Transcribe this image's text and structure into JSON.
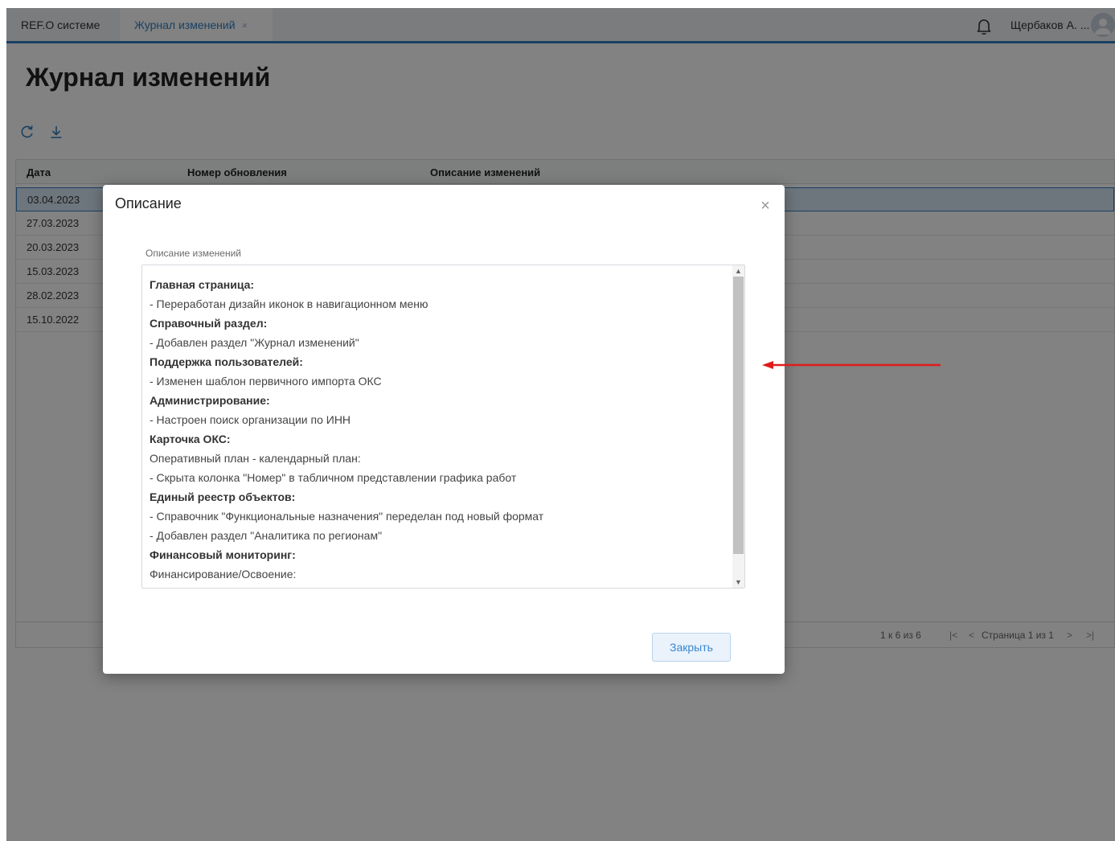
{
  "tabs": [
    {
      "label": "REF.О системе"
    },
    {
      "label": "Журнал изменений",
      "close": "×"
    }
  ],
  "user": {
    "name": "Щербаков А. ..."
  },
  "page": {
    "title": "Журнал изменений"
  },
  "grid": {
    "columns": [
      "Дата",
      "Номер обновления",
      "Описание изменений"
    ],
    "rows": [
      {
        "date": "03.04.2023",
        "selected": true
      },
      {
        "date": "27.03.2023"
      },
      {
        "date": "20.03.2023"
      },
      {
        "date": "15.03.2023"
      },
      {
        "date": "28.02.2023"
      },
      {
        "date": "15.10.2022"
      }
    ],
    "footer": {
      "count": "1 к 6 из 6",
      "first": "|<",
      "prev": "<",
      "page_text": "Страница 1 из 1",
      "next": ">",
      "last": ">|"
    }
  },
  "modal": {
    "title": "Описание",
    "close": "×",
    "field_label": "Описание изменений",
    "lines": [
      {
        "text": "Главная страница:",
        "bold": true
      },
      {
        "text": "- Переработан дизайн иконок в навигационном меню"
      },
      {
        "text": "Справочный раздел:",
        "bold": true
      },
      {
        "text": "- Добавлен раздел \"Журнал изменений\""
      },
      {
        "text": "Поддержка пользователей:",
        "bold": true
      },
      {
        "text": "- Изменен шаблон первичного импорта ОКС"
      },
      {
        "text": "Администрирование:",
        "bold": true
      },
      {
        "text": "- Настроен поиск организации по ИНН"
      },
      {
        "text": "Карточка ОКС:",
        "bold": true
      },
      {
        "text": "Оперативный план - календарный план:"
      },
      {
        "text": " - Скрыта колонка \"Номер\" в табличном представлении графика работ"
      },
      {
        "text": "Единый реестр объектов:",
        "bold": true
      },
      {
        "text": "- Справочник \"Функциональные назначения\" переделан под новый формат"
      },
      {
        "text": "- Добавлен раздел \"Аналитика по регионам\""
      },
      {
        "text": "Финансовый мониторинг:",
        "bold": true
      },
      {
        "text": "Финансирование/Освоение:"
      }
    ],
    "button": "Закрыть"
  },
  "colors": {
    "accent": "#2f7fc1",
    "selected_row": "#d6e7f6",
    "overlay": "rgba(0,0,0,0.49)",
    "arrow": "#e01b1b"
  }
}
